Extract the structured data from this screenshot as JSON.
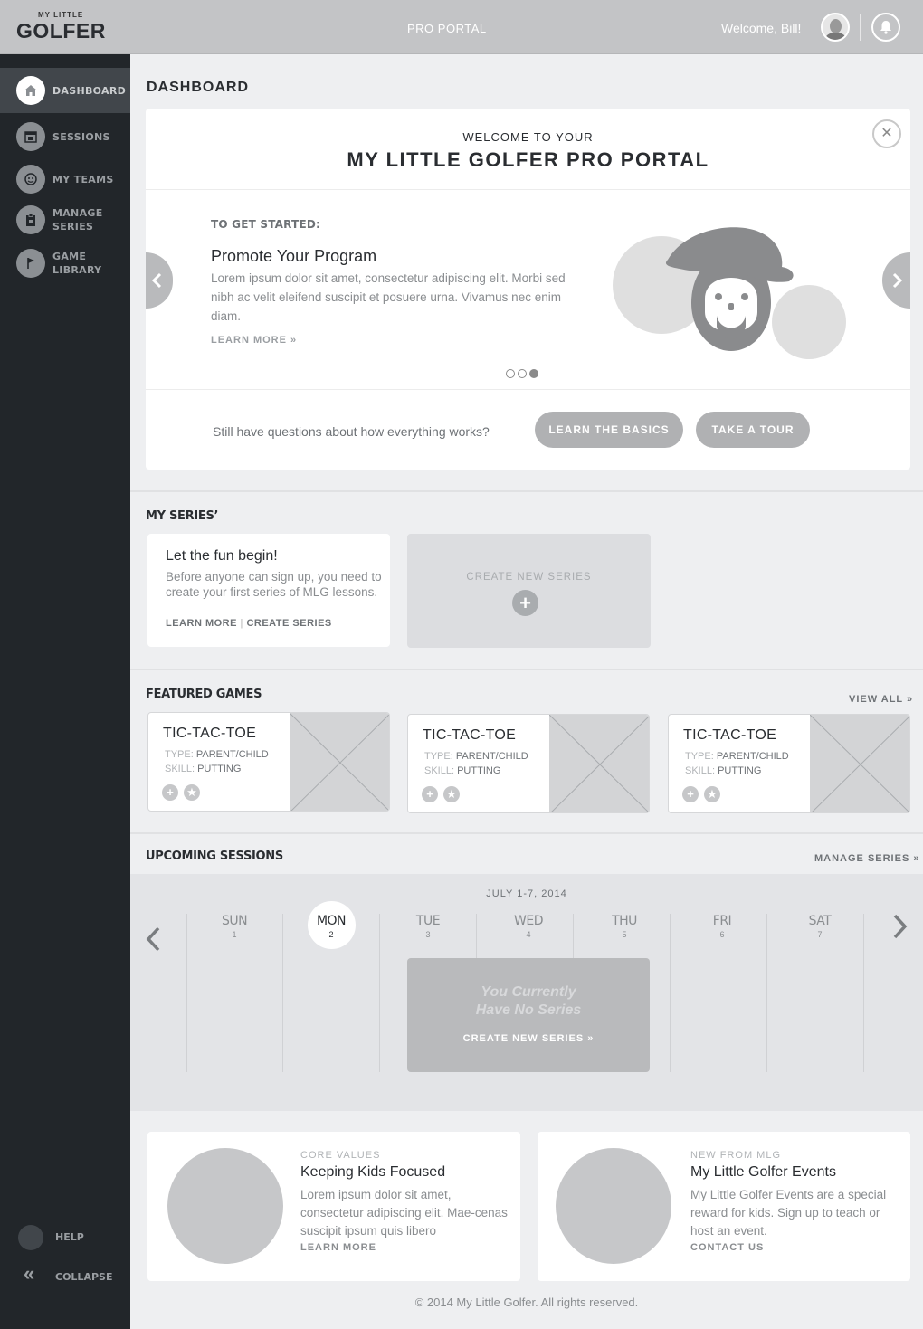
{
  "header": {
    "logo_small": "MY LITTLE",
    "logo_big": "GOLFER",
    "portal_title": "PRO PORTAL",
    "welcome": "Welcome, Bill!"
  },
  "sidebar": {
    "items": [
      {
        "label": "DASHBOARD"
      },
      {
        "label": "SESSIONS"
      },
      {
        "label": "MY TEAMS"
      },
      {
        "label": "MANAGE SERIES"
      },
      {
        "label": "GAME LIBRARY"
      }
    ],
    "help": "HELP",
    "collapse": "COLLAPSE"
  },
  "page_title": "DASHBOARD",
  "welcome_card": {
    "subtitle": "WELCOME TO YOUR",
    "title": "MY LITTLE GOLFER PRO PORTAL",
    "kicker": "TO GET STARTED:",
    "heading": "Promote Your Program",
    "body": "Lorem ipsum dolor sit amet, consectetur adipiscing elit. Morbi sed nibh ac velit eleifend suscipit et posuere urna. Vivamus nec enim diam.",
    "learn_more": "LEARN MORE »",
    "question": "Still have questions about how everything works?",
    "btn_basics": "LEARN THE BASICS",
    "btn_tour": "TAKE A TOUR"
  },
  "my_series": {
    "title": "MY SERIES’",
    "card_title": "Let the fun begin!",
    "card_body": "Before anyone can sign up, you need to create your first series of MLG lessons.",
    "learn_more": "LEARN MORE",
    "separator": "|",
    "create_series": "CREATE SERIES",
    "create_new": "CREATE NEW SERIES"
  },
  "featured_games": {
    "title": "FEATURED GAMES",
    "view_all": "VIEW ALL »",
    "games": [
      {
        "name": "TIC-TAC-TOE",
        "type_label": "TYPE:",
        "type": "PARENT/CHILD",
        "skill_label": "SKILL:",
        "skill": "PUTTING"
      },
      {
        "name": "TIC-TAC-TOE",
        "type_label": "TYPE:",
        "type": "PARENT/CHILD",
        "skill_label": "SKILL:",
        "skill": "PUTTING"
      },
      {
        "name": "TIC-TAC-TOE",
        "type_label": "TYPE:",
        "type": "PARENT/CHILD",
        "skill_label": "SKILL:",
        "skill": "PUTTING"
      }
    ]
  },
  "upcoming": {
    "title": "UPCOMING SESSIONS",
    "manage": "MANAGE SERIES »",
    "range": "JULY 1-7, 2014",
    "days": [
      {
        "day": "SUN",
        "num": "1"
      },
      {
        "day": "MON",
        "num": "2"
      },
      {
        "day": "TUE",
        "num": "3"
      },
      {
        "day": "WED",
        "num": "4"
      },
      {
        "day": "THU",
        "num": "5"
      },
      {
        "day": "FRI",
        "num": "6"
      },
      {
        "day": "SAT",
        "num": "7"
      }
    ],
    "empty_line1": "You Currently",
    "empty_line2": "Have No Series",
    "empty_link": "CREATE NEW SERIES »"
  },
  "promos": [
    {
      "kicker": "CORE VALUES",
      "title": "Keeping Kids Focused",
      "body": "Lorem ipsum dolor sit amet, consectetur adipiscing elit. Mae-cenas suscipit ipsum quis libero",
      "link": "LEARN MORE"
    },
    {
      "kicker": "NEW FROM MLG",
      "title": "My Little Golfer Events",
      "body": "My Little Golfer Events are a special reward for kids. Sign up to teach or host an event.",
      "link": "CONTACT US"
    }
  ],
  "footer": "© 2014 My Little Golfer. All rights reserved.",
  "colors": {
    "sidebar": "#22262a",
    "topbar": "#c3c4c6",
    "pill": "#b0b1b3"
  }
}
